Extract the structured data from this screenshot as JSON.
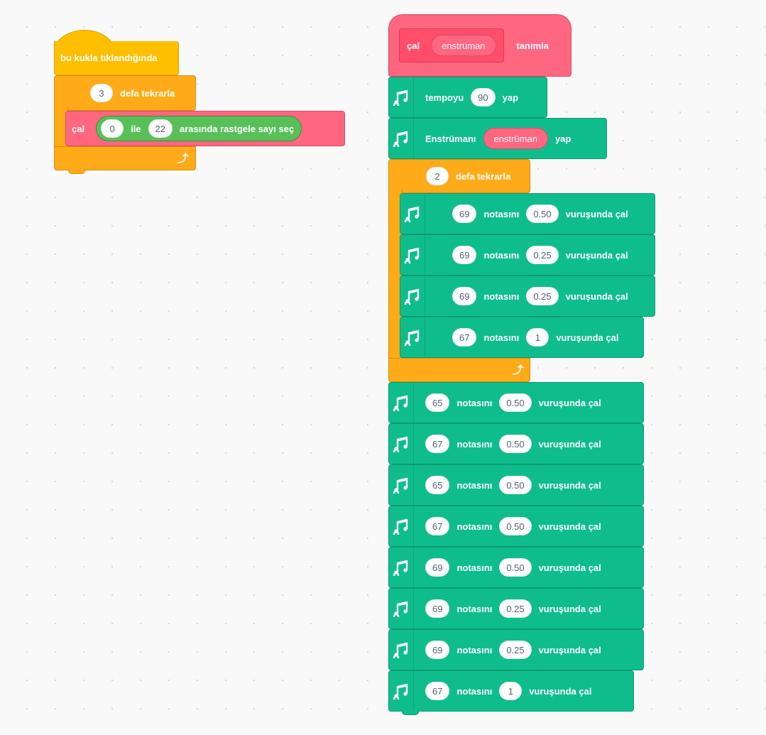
{
  "colors": {
    "events": "#ffbf00",
    "control": "#ffab19",
    "custom": "#ff6680",
    "music": "#0fbd8c",
    "operators": "#59c059",
    "canvas": "#f9f9f9"
  },
  "script1": {
    "hat_label": "bu kukla tıklandığında",
    "repeat_count": "3",
    "repeat_label": "defa tekrarla",
    "call_label": "çal",
    "random_from": "0",
    "random_and": "ile",
    "random_to": "22",
    "random_label": "arasında rastgele sayı seç",
    "loop_icon": "loop-arrow-icon"
  },
  "script2": {
    "define_play": "çal",
    "define_param": "enstrüman",
    "define_label": "tanımla",
    "tempo_label": "tempoyu",
    "tempo_value": "90",
    "tempo_suffix": "yap",
    "instrument_label": "Enstrümanı",
    "instrument_param": "enstrüman",
    "instrument_suffix": "yap",
    "repeat_count": "2",
    "repeat_label": "defa tekrarla",
    "note_word": "notasını",
    "beat_word": "vuruşunda çal",
    "inner_notes": [
      {
        "note": "69",
        "beats": "0.50"
      },
      {
        "note": "69",
        "beats": "0.25"
      },
      {
        "note": "69",
        "beats": "0.25"
      },
      {
        "note": "67",
        "beats": "1"
      }
    ],
    "notes": [
      {
        "note": "65",
        "beats": "0.50"
      },
      {
        "note": "67",
        "beats": "0.50"
      },
      {
        "note": "65",
        "beats": "0.50"
      },
      {
        "note": "67",
        "beats": "0.50"
      },
      {
        "note": "69",
        "beats": "0.50"
      },
      {
        "note": "69",
        "beats": "0.25"
      },
      {
        "note": "69",
        "beats": "0.25"
      },
      {
        "note": "67",
        "beats": "1"
      }
    ]
  }
}
